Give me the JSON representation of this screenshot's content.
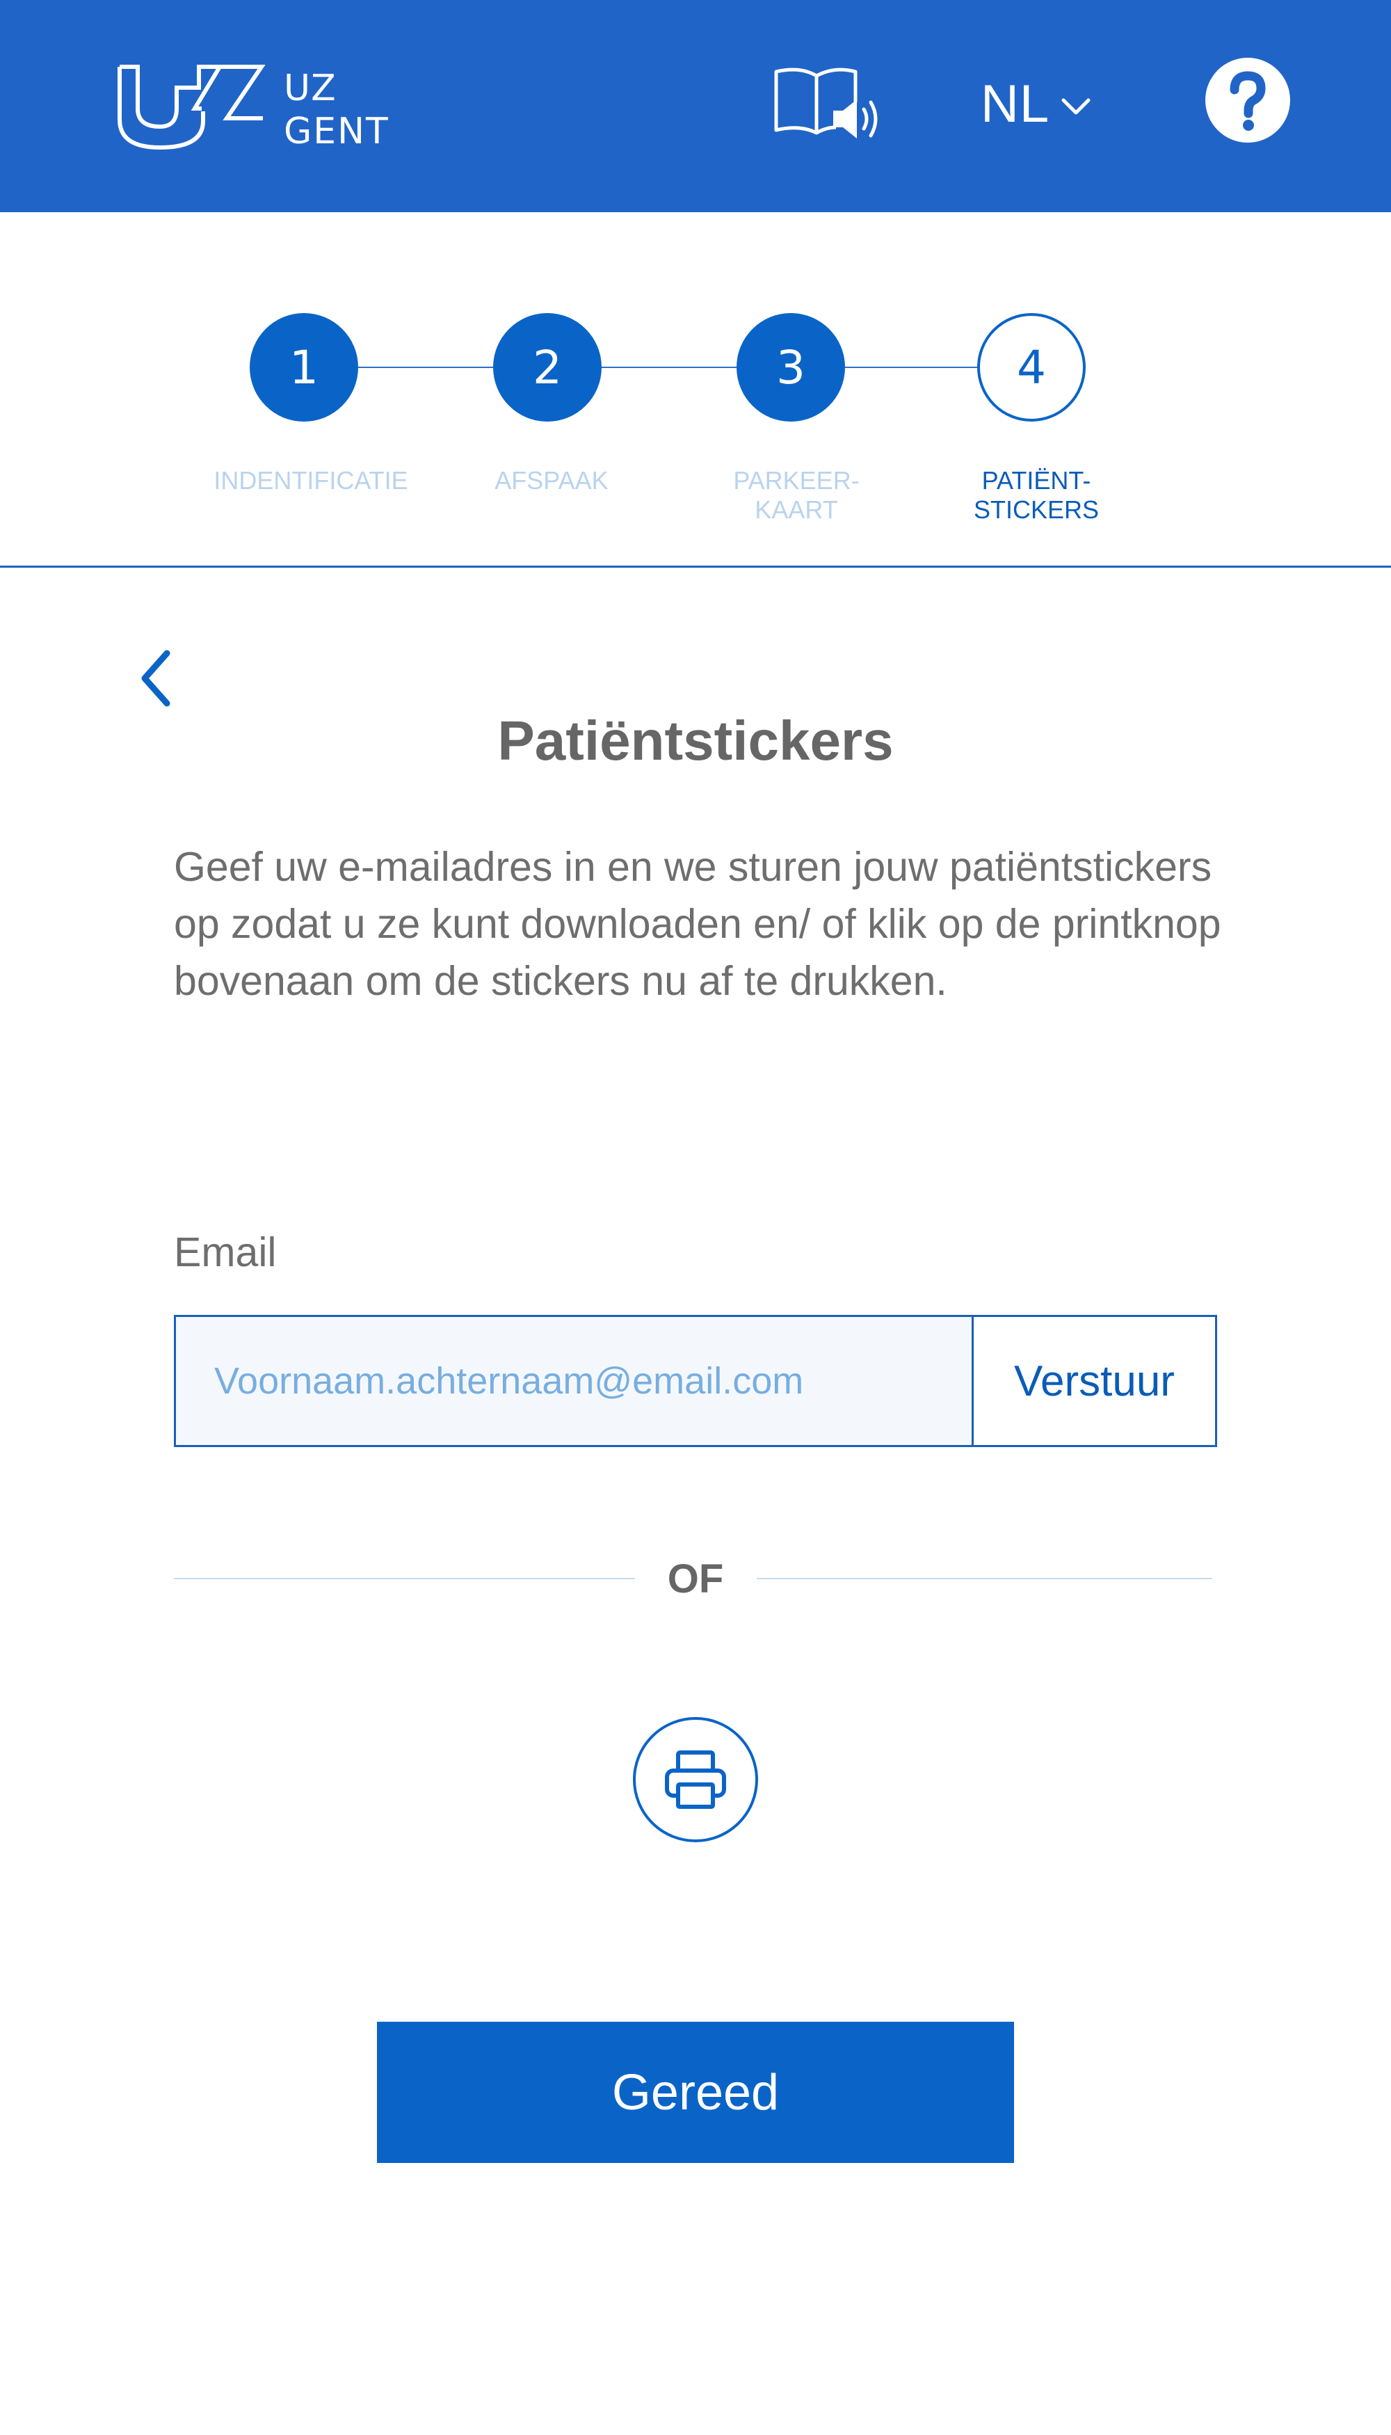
{
  "header": {
    "logo": {
      "line1": "UZ",
      "line2": "GENT"
    },
    "read_aloud_icon": "book-speaker-icon",
    "language": {
      "selected": "NL",
      "icon": "chevron-down-icon"
    },
    "help_icon": "question-mark-icon"
  },
  "stepper": {
    "steps": [
      {
        "number": "1",
        "label": "INDENTIFICATIE",
        "state": "done"
      },
      {
        "number": "2",
        "label": "AFSPAAK",
        "state": "done"
      },
      {
        "number": "3",
        "label": "PARKEER-\nKAART",
        "state": "done"
      },
      {
        "number": "4",
        "label": "PATIËNT-\nSTICKERS",
        "state": "active"
      }
    ]
  },
  "main": {
    "back_icon": "chevron-left-icon",
    "title": "Patiëntstickers",
    "description": "Geef uw e-mailadres in en we sturen jouw patiëntstickers op zodat u ze kunt downloaden en/ of klik op de printknop bovenaan om de stickers nu af te drukken.",
    "email": {
      "label": "Email",
      "placeholder": "Voornaam.achternaam@email.com",
      "value": "",
      "send_label": "Verstuur"
    },
    "separator_label": "OF",
    "print_icon": "printer-icon",
    "done_label": "Gereed"
  },
  "colors": {
    "header_bg": "#2164c8",
    "primary": "#0a64c8",
    "text_gray": "#6e6e6e",
    "done_label": "#b9d3ee"
  }
}
